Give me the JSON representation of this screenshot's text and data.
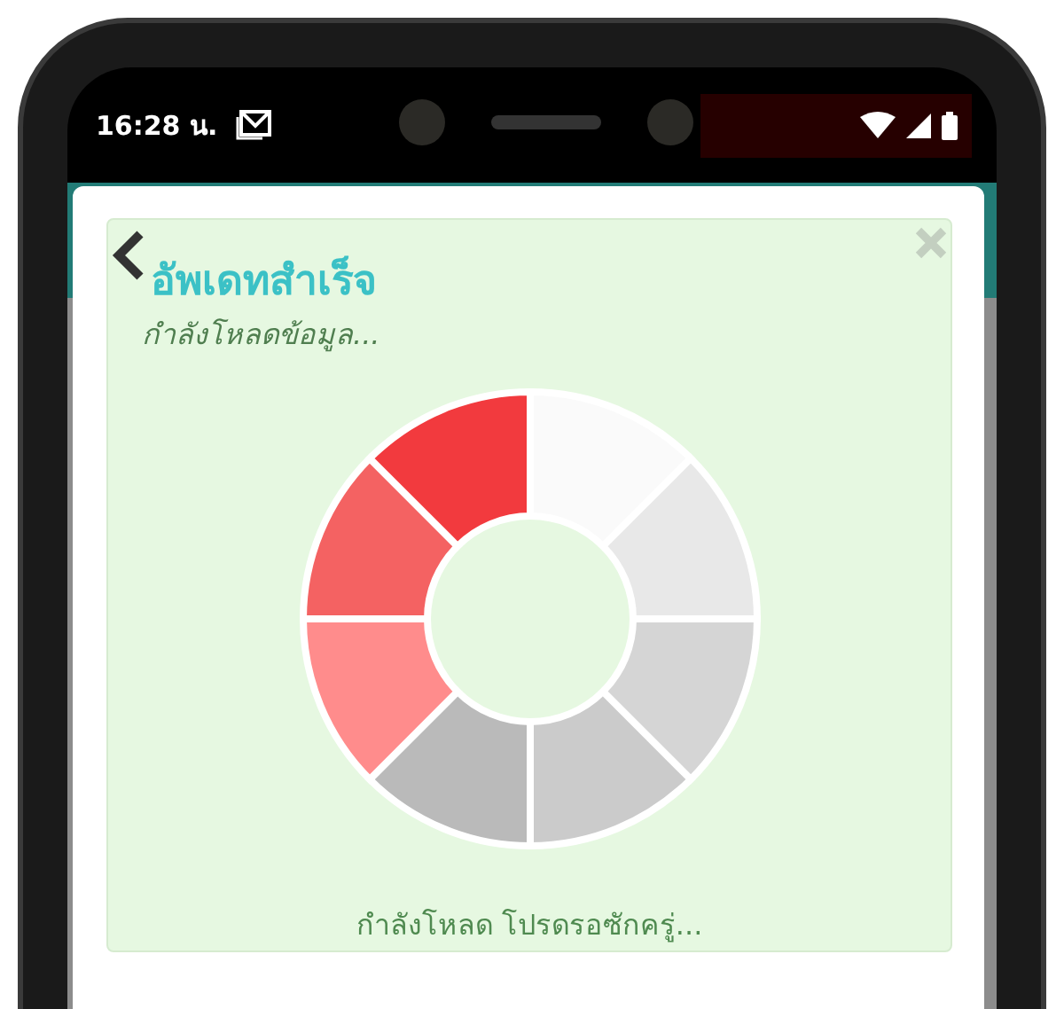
{
  "status_bar": {
    "time": "16:28 น."
  },
  "dialog": {
    "title": "อัพเดทสำเร็จ",
    "subtitle": "กำลังโหลดข้อมูล...",
    "message": "กำลังโหลด โปรดรอซักครู่..."
  }
}
